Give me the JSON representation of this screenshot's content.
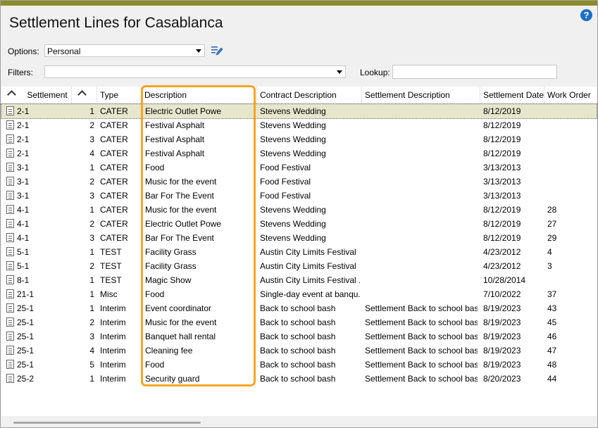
{
  "title": "Settlement Lines for Casablanca",
  "options": {
    "label": "Options:",
    "value": "Personal"
  },
  "filters": {
    "label": "Filters:",
    "value": ""
  },
  "lookup": {
    "label": "Lookup:",
    "value": ""
  },
  "columns": [
    "Settlement",
    "",
    "Type",
    "Description",
    "Contract Description",
    "Settlement Description",
    "Settlement Date",
    "Work Order"
  ],
  "rows": [
    {
      "settlement": "2-1",
      "line": "1",
      "type": "CATER",
      "description": "Electric Outlet Powe",
      "contract": "Stevens Wedding",
      "sdesc": "",
      "date": "8/12/2019",
      "wo": ""
    },
    {
      "settlement": "2-1",
      "line": "2",
      "type": "CATER",
      "description": "Festival Asphalt",
      "contract": "Stevens Wedding",
      "sdesc": "",
      "date": "8/12/2019",
      "wo": ""
    },
    {
      "settlement": "2-1",
      "line": "3",
      "type": "CATER",
      "description": "Festival Asphalt",
      "contract": "Stevens Wedding",
      "sdesc": "",
      "date": "8/12/2019",
      "wo": ""
    },
    {
      "settlement": "2-1",
      "line": "4",
      "type": "CATER",
      "description": "Festival Asphalt",
      "contract": "Stevens Wedding",
      "sdesc": "",
      "date": "8/12/2019",
      "wo": ""
    },
    {
      "settlement": "3-1",
      "line": "1",
      "type": "CATER",
      "description": "Food",
      "contract": "Food Festival",
      "sdesc": "",
      "date": "3/13/2013",
      "wo": ""
    },
    {
      "settlement": "3-1",
      "line": "2",
      "type": "CATER",
      "description": "Music for the event",
      "contract": "Food Festival",
      "sdesc": "",
      "date": "3/13/2013",
      "wo": ""
    },
    {
      "settlement": "3-1",
      "line": "3",
      "type": "CATER",
      "description": "Bar For The Event",
      "contract": "Food Festival",
      "sdesc": "",
      "date": "3/13/2013",
      "wo": ""
    },
    {
      "settlement": "4-1",
      "line": "1",
      "type": "CATER",
      "description": "Music for the event",
      "contract": "Stevens Wedding",
      "sdesc": "",
      "date": "8/12/2019",
      "wo": "28"
    },
    {
      "settlement": "4-1",
      "line": "2",
      "type": "CATER",
      "description": "Electric Outlet Powe",
      "contract": "Stevens Wedding",
      "sdesc": "",
      "date": "8/12/2019",
      "wo": "27"
    },
    {
      "settlement": "4-1",
      "line": "3",
      "type": "CATER",
      "description": "Bar For The Event",
      "contract": "Stevens Wedding",
      "sdesc": "",
      "date": "8/12/2019",
      "wo": "29"
    },
    {
      "settlement": "5-1",
      "line": "1",
      "type": "TEST",
      "description": "Facility Grass",
      "contract": "Austin City Limits Festival",
      "sdesc": "",
      "date": "4/23/2012",
      "wo": "4"
    },
    {
      "settlement": "5-1",
      "line": "2",
      "type": "TEST",
      "description": "Facility Grass",
      "contract": "Austin City Limits Festival",
      "sdesc": "",
      "date": "4/23/2012",
      "wo": "3"
    },
    {
      "settlement": "8-1",
      "line": "1",
      "type": "TEST",
      "description": "Magic Show",
      "contract": "Austin City Limits Festival ...",
      "sdesc": "",
      "date": "10/28/2014",
      "wo": ""
    },
    {
      "settlement": "21-1",
      "line": "1",
      "type": "Misc",
      "description": "Food",
      "contract": "Single-day event at banqu...",
      "sdesc": "",
      "date": "7/10/2022",
      "wo": "37"
    },
    {
      "settlement": "25-1",
      "line": "1",
      "type": "Interim",
      "description": "Event coordinator",
      "contract": "Back to school bash",
      "sdesc": "Settlement Back to school bash,",
      "date": "8/19/2023",
      "wo": "43"
    },
    {
      "settlement": "25-1",
      "line": "2",
      "type": "Interim",
      "description": "Music for the event",
      "contract": "Back to school bash",
      "sdesc": "Settlement Back to school bash,",
      "date": "8/19/2023",
      "wo": "45"
    },
    {
      "settlement": "25-1",
      "line": "3",
      "type": "Interim",
      "description": "Banquet hall rental",
      "contract": "Back to school bash",
      "sdesc": "Settlement Back to school bash,",
      "date": "8/19/2023",
      "wo": "46"
    },
    {
      "settlement": "25-1",
      "line": "4",
      "type": "Interim",
      "description": "Cleaning fee",
      "contract": "Back to school bash",
      "sdesc": "Settlement Back to school bash,",
      "date": "8/19/2023",
      "wo": "47"
    },
    {
      "settlement": "25-1",
      "line": "5",
      "type": "Interim",
      "description": "Food",
      "contract": "Back to school bash",
      "sdesc": "Settlement Back to school bash,",
      "date": "8/19/2023",
      "wo": "48"
    },
    {
      "settlement": "25-2",
      "line": "1",
      "type": "Interim",
      "description": "Security guard",
      "contract": "Back to school bash",
      "sdesc": "Settlement Back to school bash,",
      "date": "8/20/2023",
      "wo": "44"
    }
  ]
}
